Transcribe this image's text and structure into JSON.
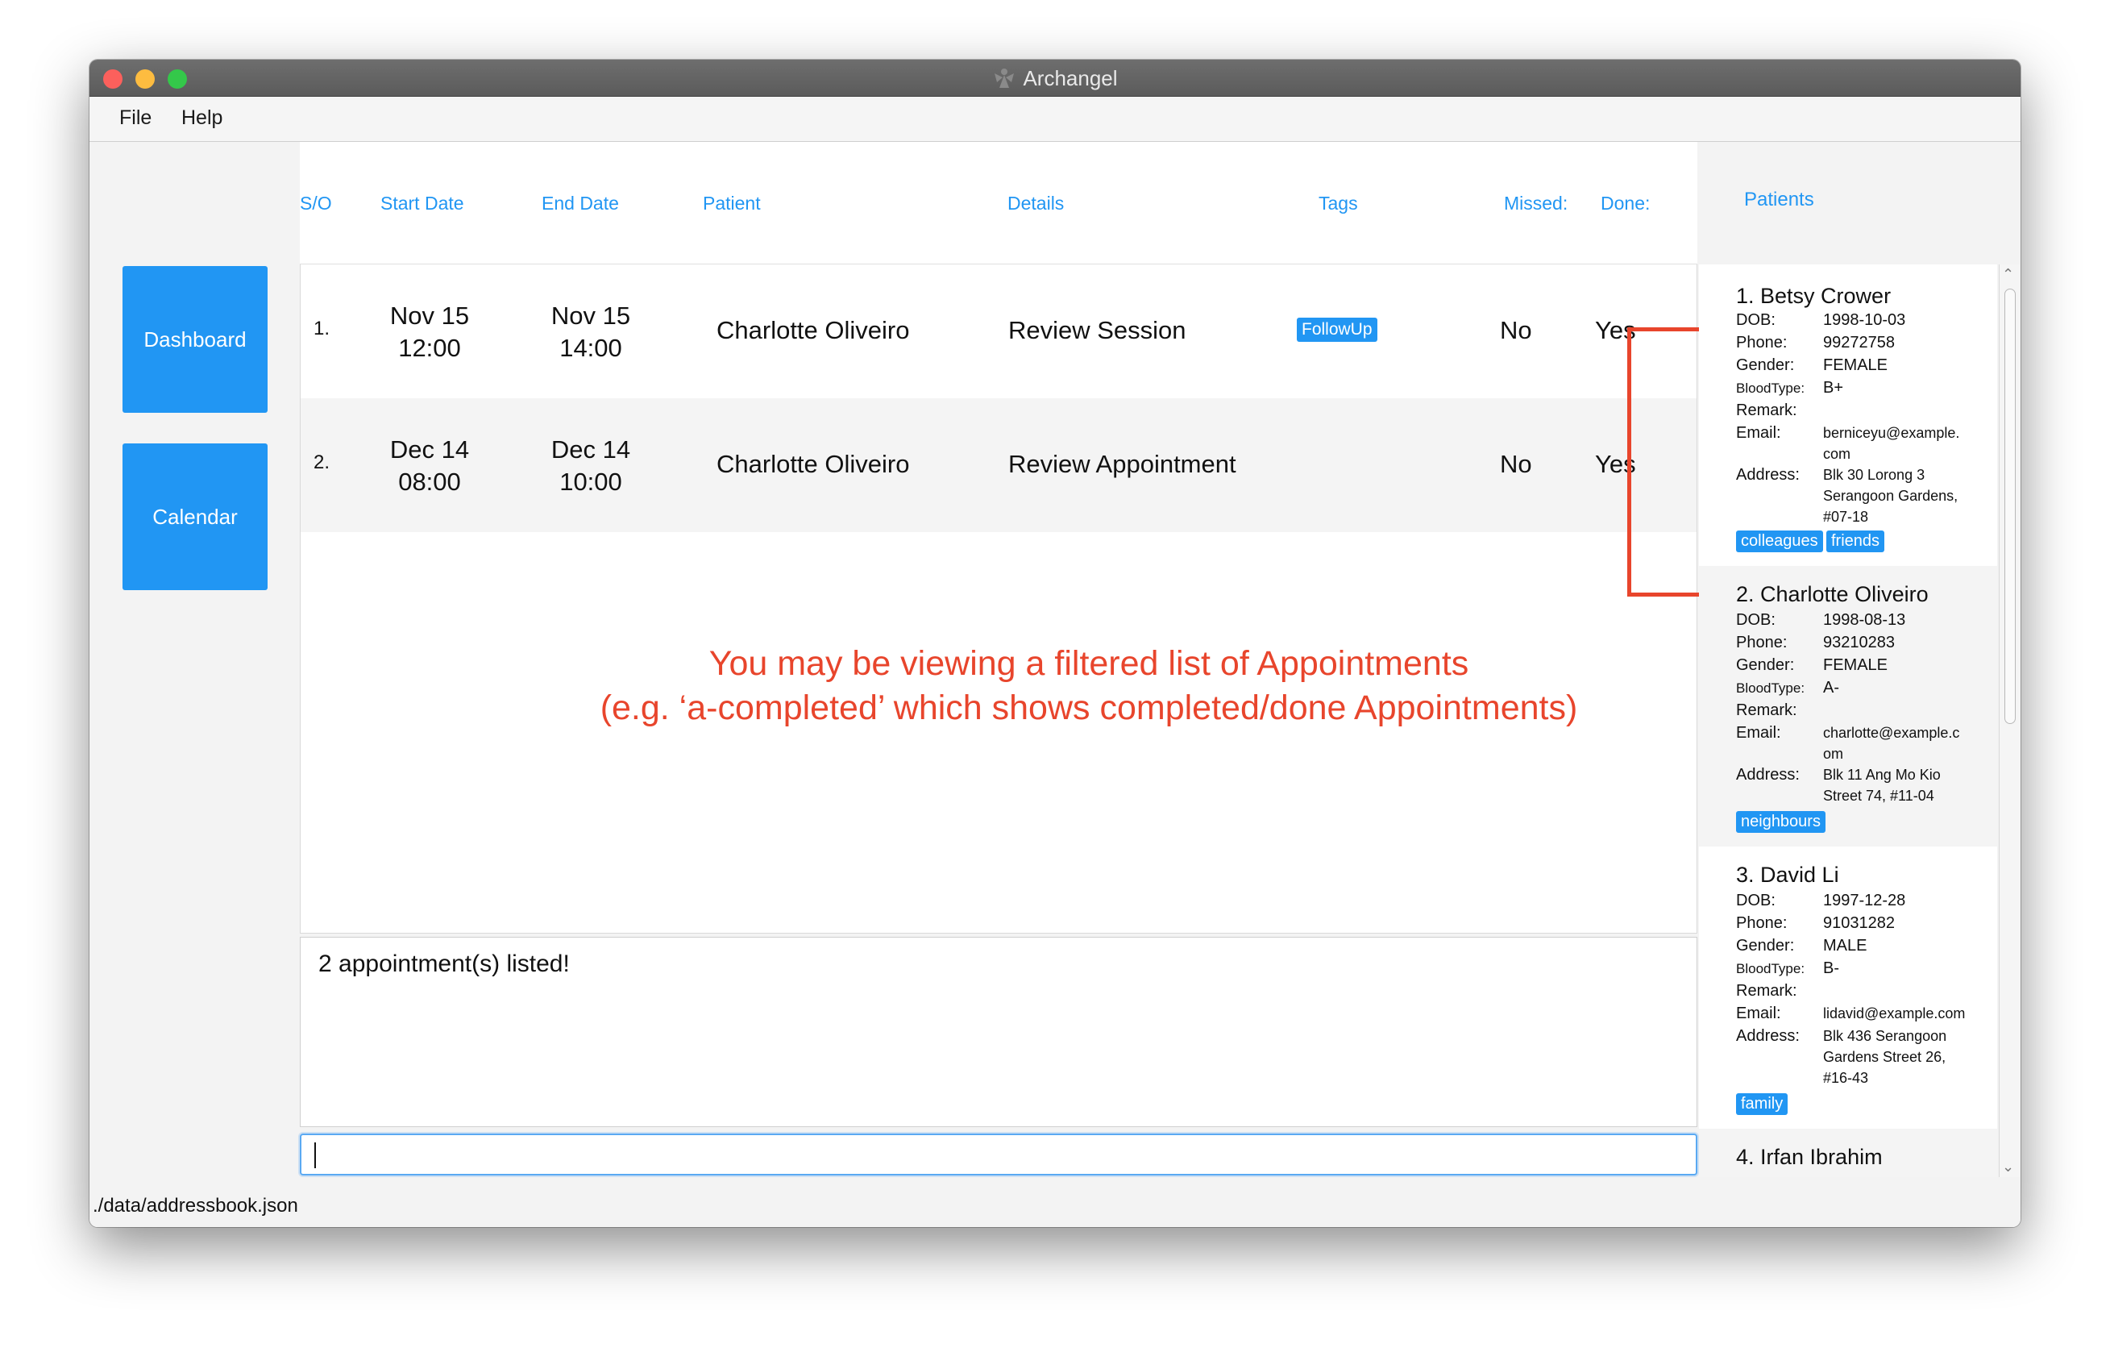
{
  "window": {
    "title": "Archangel"
  },
  "menu": {
    "file": "File",
    "help": "Help"
  },
  "nav": {
    "dashboard": "Dashboard",
    "calendar": "Calendar"
  },
  "appointments": {
    "headers": {
      "so": "S/O",
      "start": "Start Date",
      "end": "End Date",
      "patient": "Patient",
      "details": "Details",
      "tags": "Tags",
      "missed": "Missed:",
      "done": "Done:"
    },
    "rows": [
      {
        "so": "1.",
        "start_date": "Nov 15",
        "start_time": "12:00",
        "end_date": "Nov 15",
        "end_time": "14:00",
        "patient": "Charlotte Oliveiro",
        "details": "Review Session",
        "tag": "FollowUp",
        "missed": "No",
        "done": "Yes"
      },
      {
        "so": "2.",
        "start_date": "Dec 14",
        "start_time": "08:00",
        "end_date": "Dec 14",
        "end_time": "10:00",
        "patient": "Charlotte Oliveiro",
        "details": "Review Appointment",
        "tag": "",
        "missed": "No",
        "done": "Yes"
      }
    ]
  },
  "annotation": {
    "line1": "You may be viewing a filtered list of Appointments",
    "line2": "(e.g. ‘a-completed’ which shows completed/done Appointments)",
    "color": "#e8452c"
  },
  "result": {
    "text": "2 appointment(s) listed!"
  },
  "command": {
    "value": ""
  },
  "patients": {
    "title": "Patients",
    "labels": {
      "dob": "DOB:",
      "phone": "Phone:",
      "gender": "Gender:",
      "bloodtype": "BloodType:",
      "remark": "Remark:",
      "email": "Email:",
      "address": "Address:"
    },
    "items": [
      {
        "name": "1. Betsy Crower",
        "dob": "1998-10-03",
        "phone": "99272758",
        "gender": "FEMALE",
        "bloodtype": "B+",
        "remark": "",
        "email_1": "berniceyu@example.",
        "email_2": "com",
        "address_1": "Blk 30 Lorong 3",
        "address_2": "Serangoon Gardens,",
        "address_3": "#07-18",
        "tags": [
          "colleagues",
          "friends"
        ]
      },
      {
        "name": "2. Charlotte Oliveiro",
        "dob": "1998-08-13",
        "phone": "93210283",
        "gender": "FEMALE",
        "bloodtype": "A-",
        "remark": "",
        "email_1": "charlotte@example.c",
        "email_2": "om",
        "address_1": "Blk 11 Ang Mo Kio",
        "address_2": "Street 74, #11-04",
        "tags": [
          "neighbours"
        ]
      },
      {
        "name": "3. David Li",
        "dob": "1997-12-28",
        "phone": "91031282",
        "gender": "MALE",
        "bloodtype": "B-",
        "remark": "",
        "email_1": "lidavid@example.com",
        "address_1": "Blk 436 Serangoon",
        "address_2": "Gardens Street 26,",
        "address_3": "#16-43",
        "tags": [
          "family"
        ]
      },
      {
        "name": "4. Irfan Ibrahim"
      }
    ]
  },
  "status": {
    "path": "./data/addressbook.json"
  },
  "colors": {
    "accent": "#2196f3",
    "highlight": "#e8452c"
  }
}
